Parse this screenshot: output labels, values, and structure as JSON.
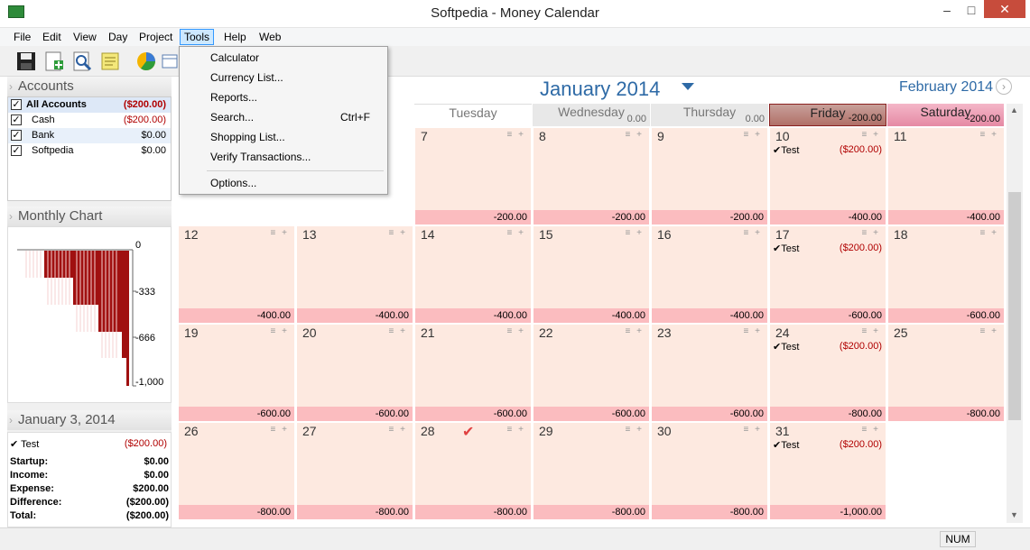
{
  "window": {
    "title": "Softpedia - Money Calendar"
  },
  "menu": [
    "File",
    "Edit",
    "View",
    "Day",
    "Project",
    "Tools",
    "Help",
    "Web"
  ],
  "tools_menu": {
    "items": [
      "Calculator",
      "Currency List...",
      "Reports...",
      "Search...",
      "Shopping List...",
      "Verify Transactions...",
      "Options..."
    ],
    "search_shortcut": "Ctrl+F"
  },
  "accounts": {
    "title": "Accounts",
    "rows": [
      {
        "name": "All Accounts",
        "amount": "($200.00)",
        "checked": true
      },
      {
        "name": "Cash",
        "amount": "($200.00)",
        "checked": true
      },
      {
        "name": "Bank",
        "amount": "$0.00",
        "checked": true
      },
      {
        "name": "Softpedia",
        "amount": "$0.00",
        "checked": true
      }
    ]
  },
  "monthly_chart": {
    "title": "Monthly Chart",
    "ticks": [
      "0",
      "-333",
      "-666",
      "-1,000"
    ]
  },
  "day_panel": {
    "title": "January 3, 2014",
    "transaction": {
      "name": "Test",
      "amount": "($200.00)"
    },
    "summary": [
      {
        "label": "Startup:",
        "value": "$0.00"
      },
      {
        "label": "Income:",
        "value": "$0.00"
      },
      {
        "label": "Expense:",
        "value": "$200.00"
      },
      {
        "label": "Difference:",
        "value": "($200.00)"
      },
      {
        "label": "Total:",
        "value": "($200.00)"
      }
    ]
  },
  "calendar": {
    "month": "January 2014",
    "next_month": "February 2014",
    "day_headers": [
      {
        "name": "Tuesday",
        "total": ""
      },
      {
        "name": "Wednesday",
        "total": "0.00"
      },
      {
        "name": "Thursday",
        "total": "0.00"
      },
      {
        "name": "Friday",
        "total": "-200.00"
      },
      {
        "name": "Saturday",
        "total": "-200.00"
      }
    ],
    "weeks": [
      [
        "",
        "",
        "7",
        "8",
        "9",
        "10",
        "11"
      ],
      [
        "12",
        "13",
        "14",
        "15",
        "16",
        "17",
        "18"
      ],
      [
        "19",
        "20",
        "21",
        "22",
        "23",
        "24",
        "25"
      ],
      [
        "26",
        "27",
        "28",
        "29",
        "30",
        "31",
        ""
      ]
    ],
    "balances": [
      [
        "-200.00",
        "-200.00",
        "-200.00",
        "-200.00",
        "-200.00",
        "-400.00",
        "-400.00"
      ],
      [
        "-400.00",
        "-400.00",
        "-400.00",
        "-400.00",
        "-400.00",
        "-600.00",
        "-600.00"
      ],
      [
        "-600.00",
        "-600.00",
        "-600.00",
        "-600.00",
        "-600.00",
        "-800.00",
        "-800.00"
      ],
      [
        "-800.00",
        "-800.00",
        "-800.00",
        "-800.00",
        "-800.00",
        "-1,000.00",
        ""
      ]
    ],
    "transaction": {
      "name": "Test",
      "amount": "($200.00)"
    }
  },
  "status": {
    "num": "NUM"
  },
  "colors": {
    "accent": "#2e6aa6",
    "cell": "#fde9e0",
    "balance": "#fbbcbf",
    "negative": "#b00000",
    "chart_bar": "#a01010"
  }
}
